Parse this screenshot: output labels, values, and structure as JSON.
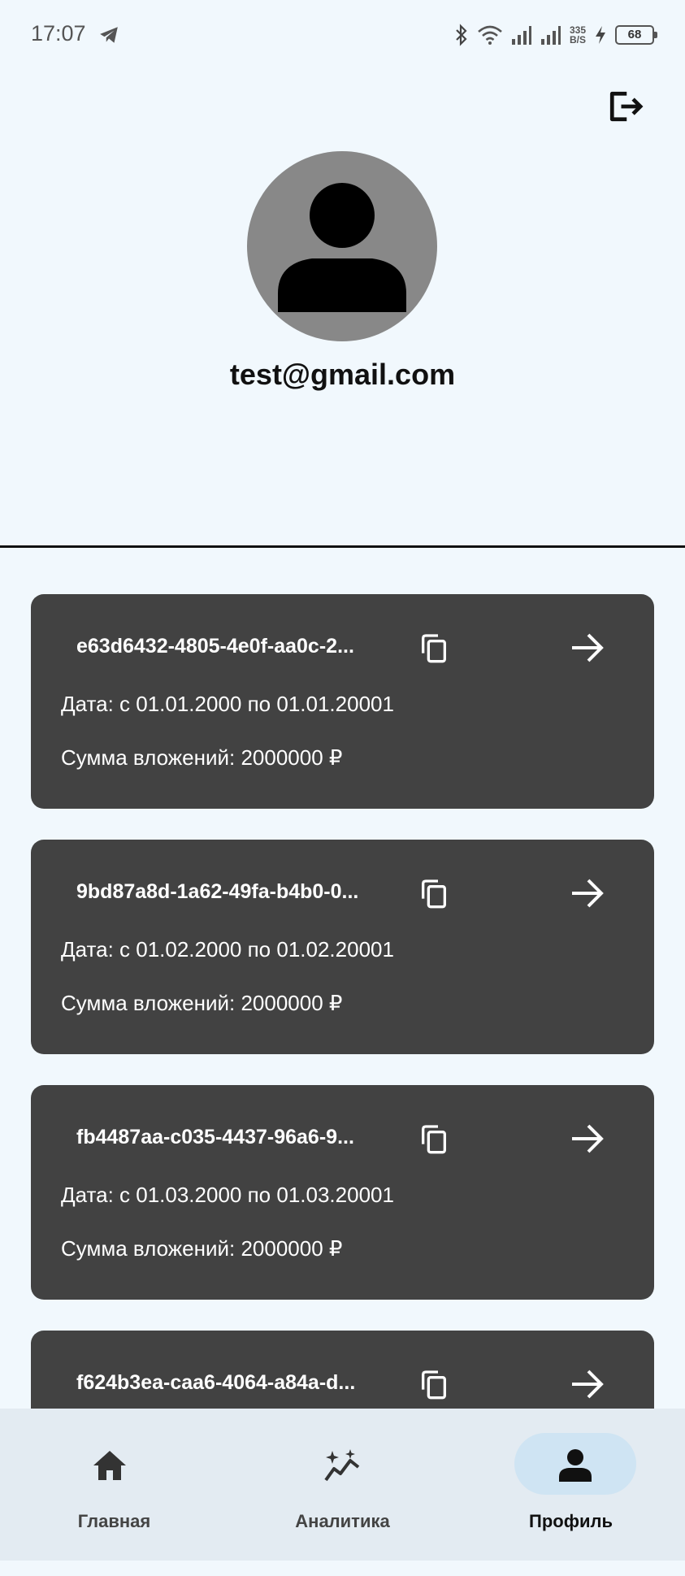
{
  "status_bar": {
    "time": "17:07",
    "net_speed_value": "335",
    "net_speed_unit": "B/S",
    "battery": "68",
    "icons": [
      "telegram-icon",
      "bluetooth-icon",
      "wifi-icon",
      "signal-icon",
      "signal-icon",
      "charging-icon",
      "battery-icon"
    ]
  },
  "profile": {
    "email": "test@gmail.com",
    "logout_icon": "logout-icon"
  },
  "investments": [
    {
      "id": "e63d6432-4805-4e0f-aa0c-2...",
      "date": "Дата: с 01.01.2000 по 01.01.20001",
      "sum": "Сумма вложений: 2000000 ₽"
    },
    {
      "id": "9bd87a8d-1a62-49fa-b4b0-0...",
      "date": "Дата: с 01.02.2000 по 01.02.20001",
      "sum": "Сумма вложений: 2000000 ₽"
    },
    {
      "id": "fb4487aa-c035-4437-96a6-9...",
      "date": "Дата: с 01.03.2000 по 01.03.20001",
      "sum": "Сумма вложений: 2000000 ₽"
    },
    {
      "id": "f624b3ea-caa6-4064-a84a-d...",
      "date": "",
      "sum": ""
    }
  ],
  "nav": {
    "home": "Главная",
    "analytics": "Аналитика",
    "profile": "Профиль",
    "active": "profile"
  },
  "colors": {
    "background": "#f1f8fd",
    "card": "#424242",
    "nav_bar": "#e3ebf2",
    "nav_active_pill": "#cfe4f3"
  }
}
